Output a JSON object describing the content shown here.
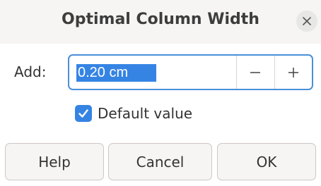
{
  "dialog": {
    "title": "Optimal Column Width",
    "close_icon": "close-icon"
  },
  "add_field": {
    "label": "Add:",
    "value": "0.20 cm",
    "decrement_icon": "minus-icon",
    "increment_icon": "plus-icon"
  },
  "default_value": {
    "label": "Default value",
    "checked": true,
    "icon": "checkmark-icon"
  },
  "buttons": {
    "help": "Help",
    "cancel": "Cancel",
    "ok": "OK"
  },
  "colors": {
    "accent": "#3584e4",
    "focus_border": "#4a90d9",
    "titlebar_bg": "#f6f5f4",
    "button_bg": "#f6f5f4"
  }
}
